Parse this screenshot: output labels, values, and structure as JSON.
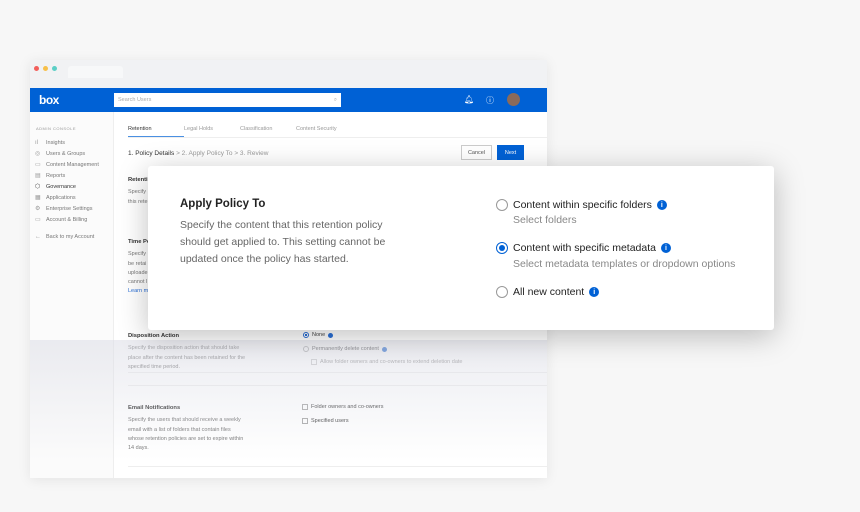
{
  "topbar": {
    "logo": "box",
    "search_placeholder": "Search Users",
    "search_icon": "magnifier",
    "bell_icon": "bell",
    "help_icon": "question-circle"
  },
  "sidebar": {
    "heading": "ADMIN CONSOLE",
    "items": [
      {
        "label": "Insights",
        "icon": "bar-chart"
      },
      {
        "label": "Users & Groups",
        "icon": "user-circle"
      },
      {
        "label": "Content Management",
        "icon": "folder"
      },
      {
        "label": "Reports",
        "icon": "report"
      },
      {
        "label": "Governance",
        "icon": "shield"
      },
      {
        "label": "Applications",
        "icon": "grid"
      },
      {
        "label": "Enterprise Settings",
        "icon": "gear"
      },
      {
        "label": "Account & Billing",
        "icon": "credit-card"
      }
    ],
    "back": "Back to my Account"
  },
  "tabs": [
    "Retention",
    "Legal Holds",
    "Classification",
    "Content Security"
  ],
  "steps": {
    "s1": "1. Policy Details",
    "s2": "2. Apply Policy To",
    "s3": "3. Review",
    "sep": ">"
  },
  "buttons": {
    "cancel": "Cancel",
    "next": "Next"
  },
  "sections": {
    "retention": {
      "title": "Retenti",
      "l1": "Specify",
      "l2": "this rete"
    },
    "time": {
      "title": "Time Pe",
      "l1": "Specify",
      "l2": "be retai",
      "l3": "uploade",
      "l4": "cannot l",
      "link": "Learn m"
    },
    "disposition": {
      "title": "Disposition Action",
      "desc": "Specify the disposition action that should take place after the content has been retained for the specified time period.",
      "opt_none": "None",
      "opt_delete": "Permanently delete content",
      "opt_allow": "Allow folder owners and co-owners to extend deletion date"
    },
    "email": {
      "title": "Email Notifications",
      "desc": "Specify the users that should receive a weekly email with a list of folders that contain files whose retention policies are set to expire within 14 days.",
      "opt_owners": "Folder owners and co-owners",
      "opt_users": "Specified users"
    }
  },
  "card": {
    "title": "Apply Policy To",
    "desc": "Specify the content that this retention policy should get applied to. This setting cannot be updated once the policy has started.",
    "options": [
      {
        "label": "Content within specific folders",
        "sub": "Select folders",
        "selected": false
      },
      {
        "label": "Content with specific metadata",
        "sub": "Select metadata templates or dropdown options",
        "selected": true
      },
      {
        "label": "All new content",
        "selected": false
      }
    ],
    "info_glyph": "i"
  },
  "colors": {
    "brand": "#0061d5"
  }
}
